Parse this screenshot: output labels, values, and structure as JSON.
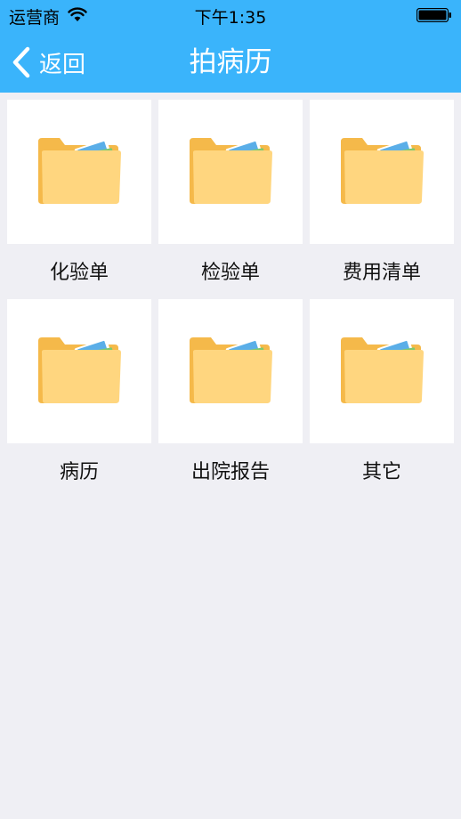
{
  "status_bar": {
    "carrier": "运营商",
    "time": "下午1:35"
  },
  "navbar": {
    "back_label": "返回",
    "title": "拍病历",
    "background_color": "#3ab4fb"
  },
  "categories": [
    {
      "label": "化验单",
      "icon": "folder-icon"
    },
    {
      "label": "检验单",
      "icon": "folder-icon"
    },
    {
      "label": "费用清单",
      "icon": "folder-icon"
    },
    {
      "label": "病历",
      "icon": "folder-icon"
    },
    {
      "label": "出院报告",
      "icon": "folder-icon"
    },
    {
      "label": "其它",
      "icon": "folder-icon"
    }
  ]
}
